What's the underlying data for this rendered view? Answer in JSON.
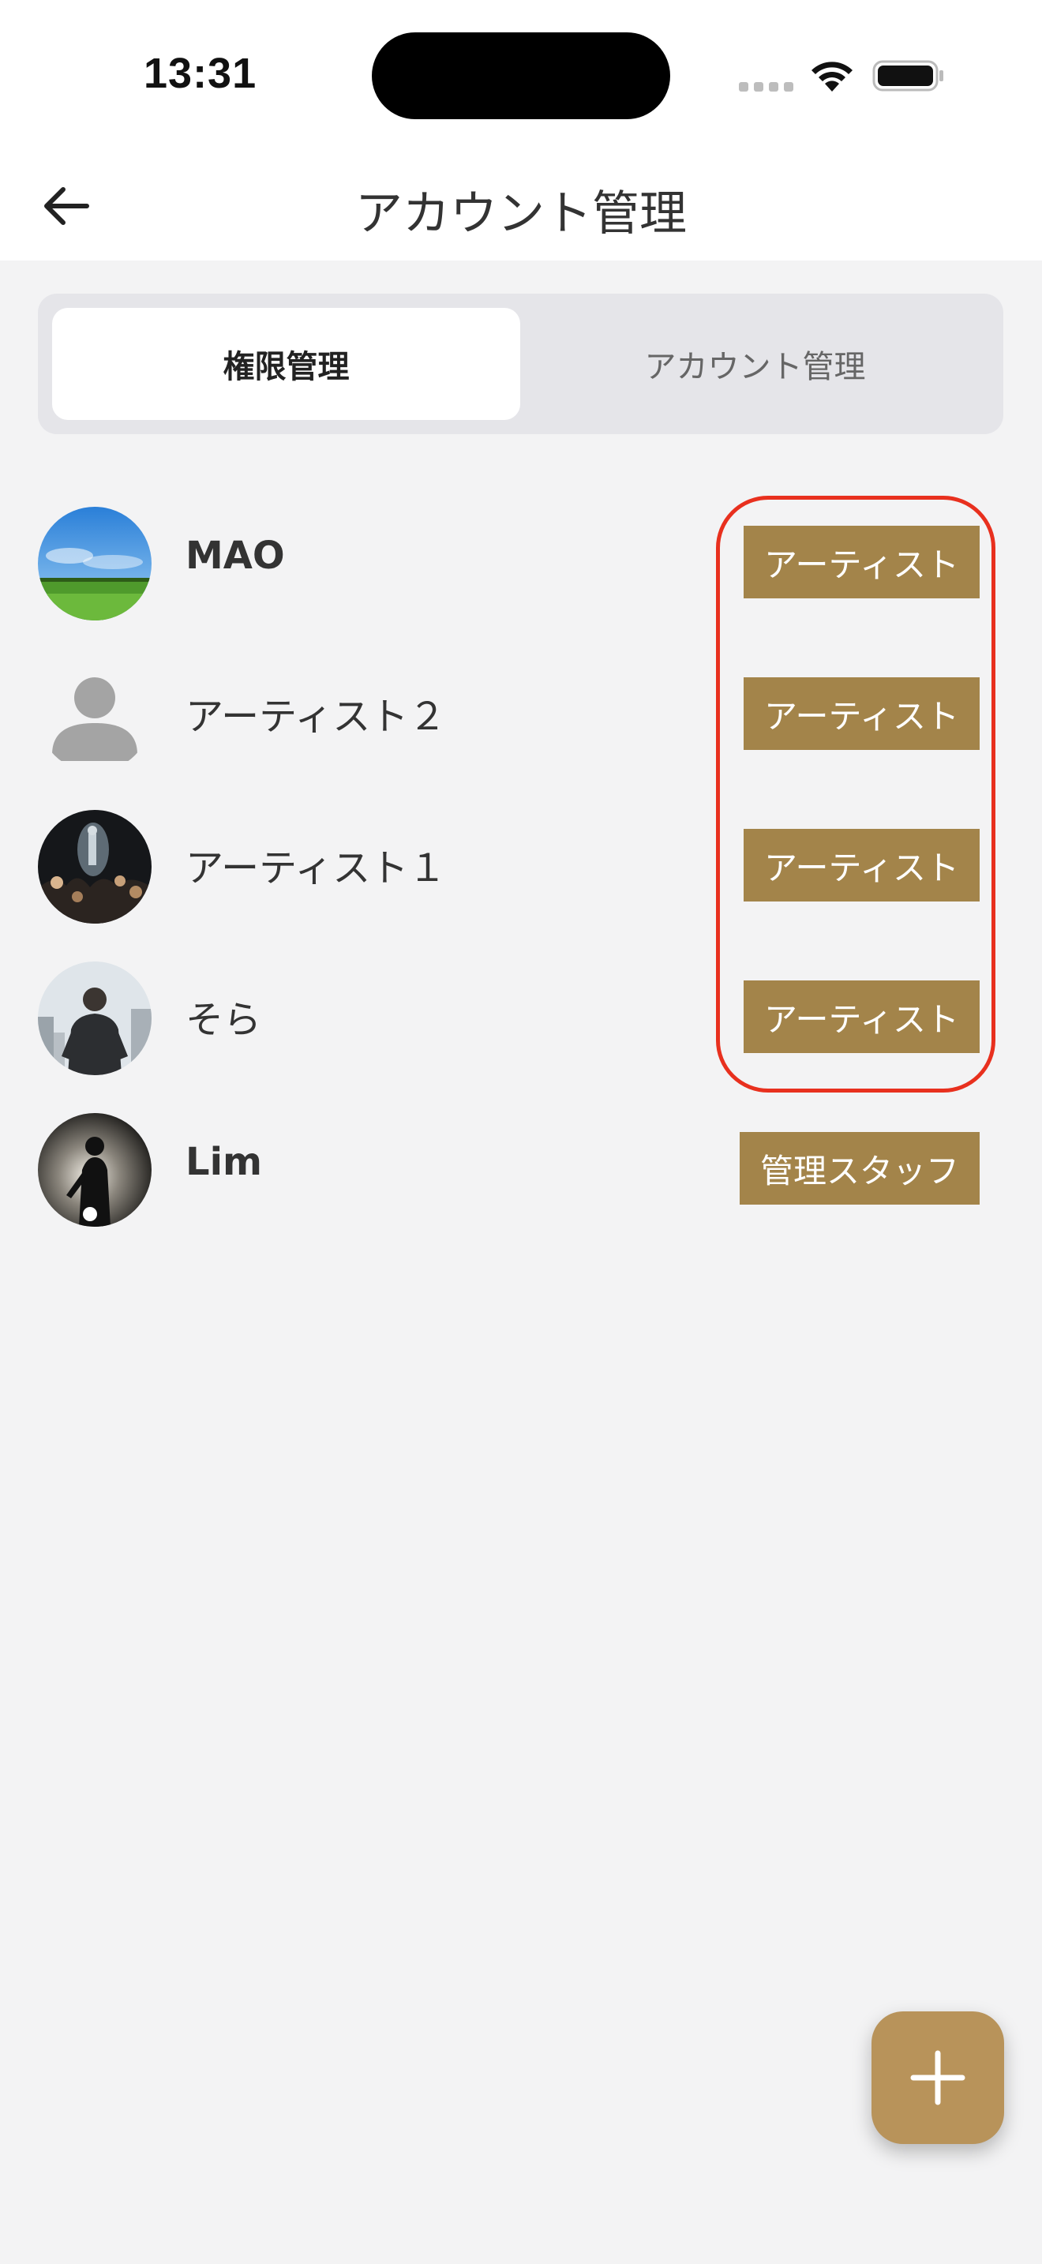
{
  "status_bar": {
    "time": "13:31",
    "icons": [
      "cellular-signal-icon",
      "wifi-icon",
      "battery-icon"
    ]
  },
  "header": {
    "title": "アカウント管理",
    "back_icon": "arrow-left-icon"
  },
  "segmented_control": {
    "tabs": [
      {
        "label": "権限管理",
        "selected": true
      },
      {
        "label": "アカウント管理",
        "selected": false
      }
    ]
  },
  "accounts": [
    {
      "name": "MAO",
      "role": "アーティスト",
      "avatar": "landscape-photo"
    },
    {
      "name": "アーティスト２",
      "role": "アーティスト",
      "avatar": "default-person-icon"
    },
    {
      "name": "アーティスト１",
      "role": "アーティスト",
      "avatar": "concert-photo"
    },
    {
      "name": "そら",
      "role": "アーティスト",
      "avatar": "businessman-photo"
    },
    {
      "name": "Lim",
      "role": "管理スタッフ",
      "avatar": "singer-silhouette-photo"
    }
  ],
  "fab": {
    "icon": "plus-icon"
  },
  "colors": {
    "badge": "#a3844a",
    "fab": "#b8935a",
    "highlight": "#e8301e",
    "background": "#f3f3f4"
  }
}
